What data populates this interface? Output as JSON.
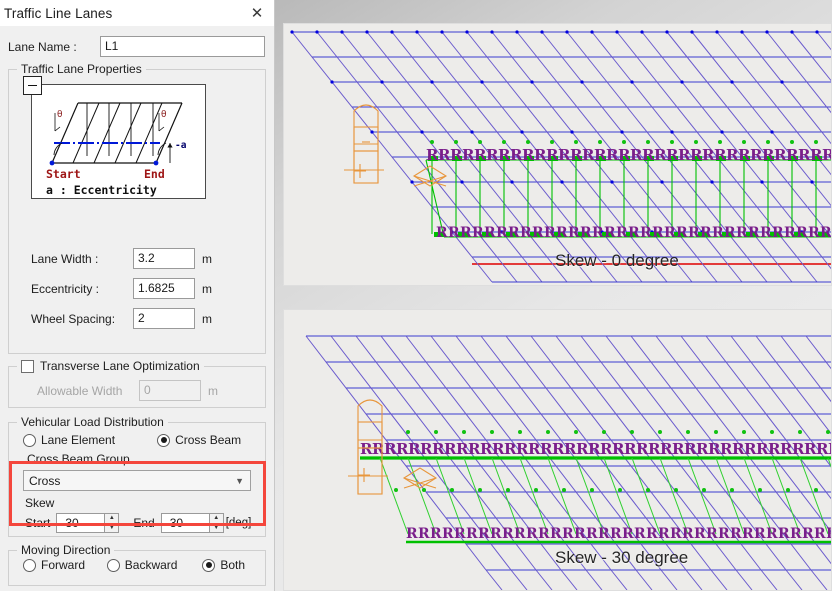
{
  "window": {
    "title": "Traffic Line Lanes",
    "close_icon": "close-icon"
  },
  "form": {
    "lane_name_label": "Lane Name :",
    "lane_name_value": "L1"
  },
  "traffic_lane_properties": {
    "group_title": "Traffic Lane Properties",
    "collapse_icon": "minus-icon",
    "diagram": {
      "start_label": "Start",
      "end_label": "End",
      "angle_symbol": "θ",
      "eccentricity_symbol": "a",
      "legend": "a : Eccentricity"
    },
    "fields": [
      {
        "label": "Lane Width :",
        "value": "3.2",
        "unit": "m"
      },
      {
        "label": "Eccentricity   :",
        "value": "1.6825",
        "unit": "m"
      },
      {
        "label": "Wheel Spacing:",
        "value": "2",
        "unit": "m"
      }
    ]
  },
  "transverse": {
    "checkbox_label": "Transverse Lane Optimization",
    "checked": false,
    "allowable_width_label": "Allowable Width",
    "allowable_width_value": "0",
    "allowable_width_unit": "m"
  },
  "vehicular_load_distribution": {
    "group_title": "Vehicular Load Distribution",
    "options": [
      {
        "label": "Lane Element",
        "selected": false
      },
      {
        "label": "Cross Beam",
        "selected": true
      }
    ],
    "cross_beam_group_label": "Cross Beam Group",
    "cross_beam_group_value": "Cross",
    "dropdown_icon": "chevron-down-icon",
    "skew_label": "Skew",
    "skew_start_label": "Start",
    "skew_start_value": "-30",
    "skew_end_label": "End",
    "skew_end_value": "-30",
    "skew_unit": "[deg]",
    "highlight_color": "#f4463c"
  },
  "moving_direction": {
    "group_title": "Moving Direction",
    "options": [
      {
        "label": "Forward",
        "selected": false
      },
      {
        "label": "Backward",
        "selected": false
      },
      {
        "label": "Both",
        "selected": true
      }
    ]
  },
  "viewport": {
    "top_view_label": "Skew - 0 degree",
    "bottom_view_label": "Skew - 30 degree",
    "colors": {
      "mesh_blue": "#2222cc",
      "mesh_purple": "#6a5acd",
      "cross_beam_green": "#00c000",
      "reaction_marker": "#7a1f8b",
      "vehicle_annotation": "#e8963c",
      "edge_red": "#e00000",
      "node_blue": "#0000e0"
    }
  }
}
